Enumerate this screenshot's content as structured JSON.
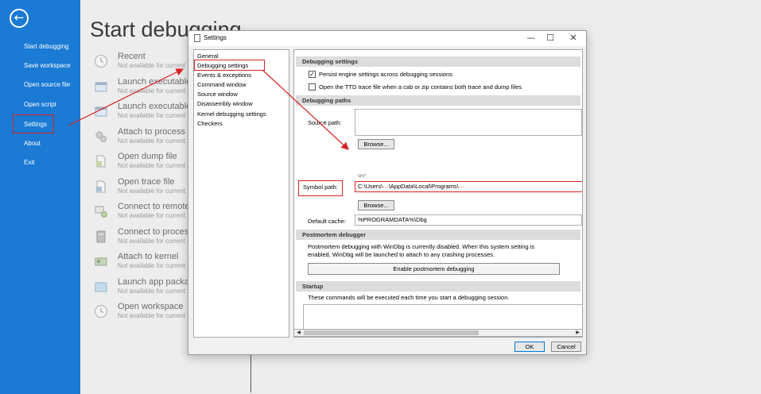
{
  "sidebar": {
    "back_glyph": "←",
    "items": [
      {
        "label": "Start debugging"
      },
      {
        "label": "Save workspace"
      },
      {
        "label": "Open source file"
      },
      {
        "label": "Open script"
      },
      {
        "label": "Settings"
      },
      {
        "label": "About"
      },
      {
        "label": "Exit"
      }
    ]
  },
  "page": {
    "title": "Start debugging",
    "items": [
      {
        "title": "Recent",
        "subtitle": "Not available for current",
        "icon": "clock-icon"
      },
      {
        "title": "Launch executable",
        "subtitle": "Not available for current",
        "icon": "executable-icon"
      },
      {
        "title": "Launch executable",
        "subtitle": "Not available for current",
        "icon": "executable-icon"
      },
      {
        "title": "Attach to process",
        "subtitle": "Not available for current",
        "icon": "gears-icon"
      },
      {
        "title": "Open dump file",
        "subtitle": "Not available for current",
        "icon": "dump-file-icon"
      },
      {
        "title": "Open trace file",
        "subtitle": "Not available for current",
        "icon": "trace-file-icon"
      },
      {
        "title": "Connect to remote",
        "subtitle": "Not available for current",
        "icon": "remote-icon"
      },
      {
        "title": "Connect to proces",
        "subtitle": "Not available for current",
        "icon": "process-server-icon"
      },
      {
        "title": "Attach to kernel",
        "subtitle": "Not available for current",
        "icon": "kernel-icon"
      },
      {
        "title": "Launch app packag",
        "subtitle": "Not available for current",
        "icon": "app-package-icon"
      },
      {
        "title": "Open workspace",
        "subtitle": "Not available for current",
        "icon": "workspace-icon"
      }
    ]
  },
  "dialog": {
    "title": "Settings",
    "controls": {
      "minimize": "—",
      "maximize": "☐",
      "close": "✕"
    },
    "tree": [
      "General",
      "Debugging settings",
      "Events & exceptions",
      "Command window",
      "Source window",
      "Disassembly window",
      "Kernel debugging settings",
      "Checkers"
    ],
    "sections": {
      "debugging_settings": "Debugging settings",
      "debugging_paths": "Debugging paths",
      "postmortem": "Postmortem debugger",
      "startup": "Startup"
    },
    "persist_label": "Persist engine settings across debugging sessions",
    "persist_checked": true,
    "ttd_label": "Open the TTD trace file when a cab or zip contains both trace and dump files",
    "ttd_checked": false,
    "source_path_label": "Source path:",
    "browse_label": "Browse...",
    "symbol_path_label": "Symbol path:",
    "symbol_path_value": "C:\\Users\\···\\AppData\\Local\\Programs\\···",
    "srv_hint": "srv*",
    "default_cache_label": "Default cache:",
    "default_cache_value": "%PROGRAMDATA%\\Dbg",
    "postmortem_text_1": "Postmortem debugging with WinDbg is currently disabled. When this system setting is",
    "postmortem_text_2": "enabled, WinDbg will be launched to attach to any crashing processes.",
    "enable_postmortem_label": "Enable postmortem debugging",
    "startup_text": "These commands will be executed each time you start a debugging session.",
    "ok_label": "OK",
    "cancel_label": "Cancel"
  },
  "colors": {
    "accent": "#1a7ad4",
    "highlight": "#d82323"
  }
}
